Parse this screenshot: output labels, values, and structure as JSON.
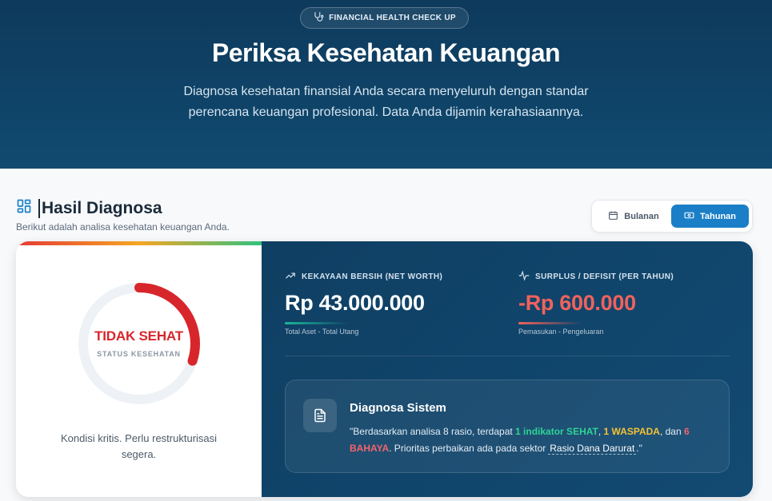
{
  "hero": {
    "badge": "FINANCIAL HEALTH CHECK UP",
    "badge_icon": "stethoscope-icon",
    "title": "Periksa Kesehatan Keuangan",
    "subtitle_line1": "Diagnosa kesehatan finansial Anda secara menyeluruh dengan standar",
    "subtitle_line2": "perencana keuangan profesional. Data Anda dijamin kerahasiaannya."
  },
  "section": {
    "title": "Hasil Diagnosa",
    "subtitle": "Berikut adalah analisa kesehatan keuangan Anda."
  },
  "period_toggle": {
    "monthly_label": "Bulanan",
    "yearly_label": "Tahunan",
    "selected": "Tahunan"
  },
  "health": {
    "status": "TIDAK SEHAT",
    "status_label": "STATUS KESEHATAN",
    "gauge_fraction": 0.3,
    "status_color": "#d7262b",
    "note": "Kondisi kritis. Perlu restrukturisasi segera."
  },
  "metrics": {
    "net_worth": {
      "label": "KEKAYAAN BERSIH (NET WORTH)",
      "value": "Rp 43.000.000",
      "footnote": "Total Aset - Total Utang",
      "accent": "#1bb59a"
    },
    "surplus": {
      "label": "SURPLUS / DEFISIT (PER TAHUN)",
      "value": "-Rp 600.000",
      "footnote": "Pemasukan - Pengeluaran",
      "accent": "#f0625c"
    }
  },
  "diagnosis": {
    "title": "Diagnosa Sistem",
    "text_prefix": "\"Berdasarkan analisa 8 rasio, terdapat ",
    "healthy": "1 indikator SEHAT",
    "sep1": ", ",
    "warning": "1 WASPADA",
    "sep2": ", dan ",
    "danger": "6 BAHAYA",
    "text_mid": ". Prioritas perbaikan ada pada sektor",
    "focus": "Rasio Dana Darurat",
    "text_suffix": ".\""
  }
}
